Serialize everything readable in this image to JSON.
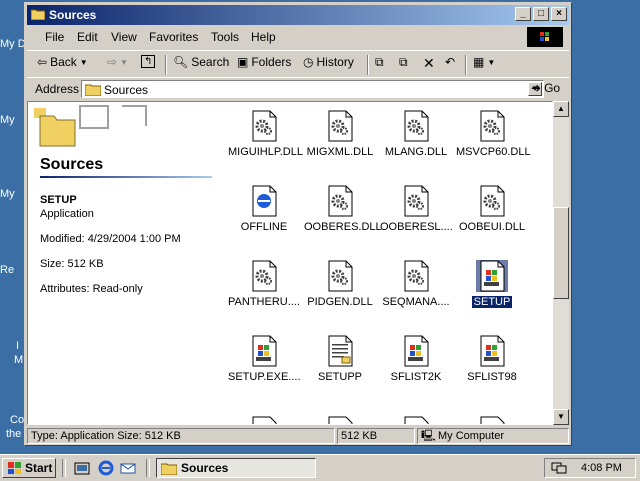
{
  "desktop_labels": [
    "My D",
    "My",
    "My",
    "Re",
    "I",
    "M",
    "Co",
    "the"
  ],
  "window": {
    "title": "Sources"
  },
  "menu": [
    "File",
    "Edit",
    "View",
    "Favorites",
    "Tools",
    "Help"
  ],
  "toolbar": {
    "back": "Back",
    "search": "Search",
    "folders": "Folders",
    "history": "History"
  },
  "address": {
    "label": "Address",
    "value": "Sources",
    "go": "Go"
  },
  "left_pane": {
    "folder_title": "Sources",
    "selected_name": "SETUP",
    "selected_type": "Application",
    "modified": "Modified: 4/29/2004 1:00 PM",
    "size": "Size: 512 KB",
    "attributes": "Attributes: Read-only"
  },
  "files": [
    {
      "name": "MIGUIHLP.DLL",
      "icon": "dll-gear-icon"
    },
    {
      "name": "MIGXML.DLL",
      "icon": "dll-gear-icon"
    },
    {
      "name": "MLANG.DLL",
      "icon": "dll-gear-icon"
    },
    {
      "name": "MSVCP60.DLL",
      "icon": "dll-gear-icon"
    },
    {
      "name": "OFFLINE",
      "icon": "html-ie-icon"
    },
    {
      "name": "OOBERES.DLL",
      "icon": "dll-gear-icon"
    },
    {
      "name": "OOBERESL....",
      "icon": "dll-gear-icon"
    },
    {
      "name": "OOBEUI.DLL",
      "icon": "dll-gear-icon"
    },
    {
      "name": "PANTHERU....",
      "icon": "dll-gear-icon"
    },
    {
      "name": "PIDGEN.DLL",
      "icon": "dll-gear-icon"
    },
    {
      "name": "SEQMANA....",
      "icon": "dll-gear-icon"
    },
    {
      "name": "SETUP",
      "icon": "setup-exe-icon",
      "selected": true
    },
    {
      "name": "SETUP.EXE....",
      "icon": "setup-exe-icon"
    },
    {
      "name": "SETUPP",
      "icon": "text-doc-icon"
    },
    {
      "name": "SFLIST2K",
      "icon": "setup-exe-icon"
    },
    {
      "name": "SFLIST98",
      "icon": "setup-exe-icon"
    }
  ],
  "status": {
    "info": "Type: Application Size: 512 KB",
    "size": "512 KB",
    "zone": "My Computer"
  },
  "taskbar": {
    "start": "Start",
    "task": "Sources",
    "clock": "4:08 PM"
  },
  "colors": {
    "desktop": "#3a6ea5",
    "titlebar": "#0a246a",
    "selection": "#0a246a"
  }
}
